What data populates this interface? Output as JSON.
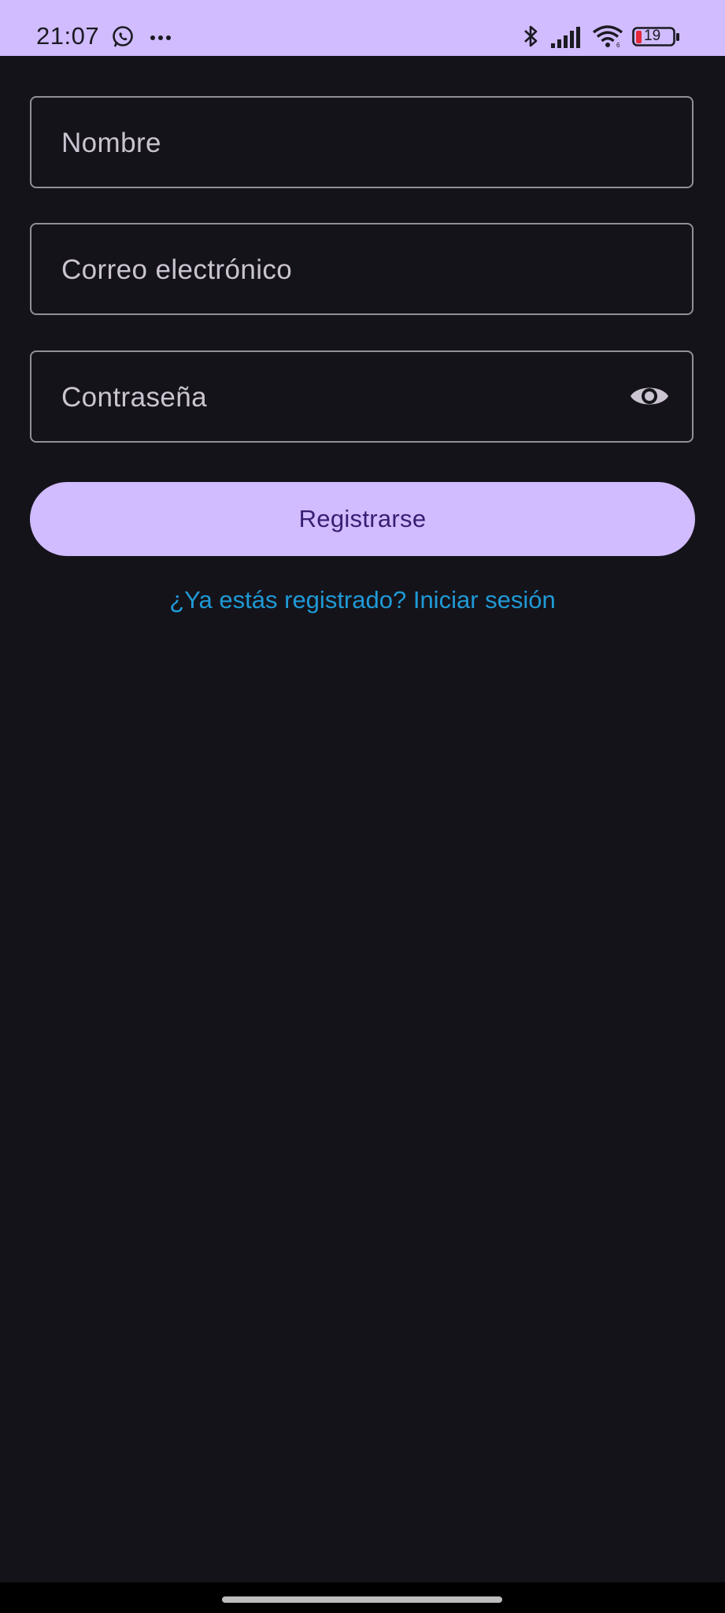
{
  "status_bar": {
    "time": "21:07",
    "battery_level": "19",
    "background_color": "#d0bcff",
    "icons": [
      "whatsapp-icon",
      "more-icon",
      "bluetooth-icon",
      "signal-icon",
      "wifi-icon",
      "battery-icon"
    ]
  },
  "form": {
    "name_field": {
      "label": "Nombre",
      "value": ""
    },
    "email_field": {
      "label": "Correo electrónico",
      "value": ""
    },
    "password_field": {
      "label": "Contraseña",
      "value": "",
      "toggle_icon": "eye-icon"
    }
  },
  "register_button": {
    "label": "Registrarse",
    "background_color": "#d0bcff",
    "text_color": "#381e72"
  },
  "login_link": {
    "text": "¿Ya estás registrado? Iniciar sesión",
    "color": "#1f9ad6"
  },
  "theme": {
    "background": "#15131a",
    "field_border": "#938f99",
    "field_label": "#cac4d0"
  }
}
